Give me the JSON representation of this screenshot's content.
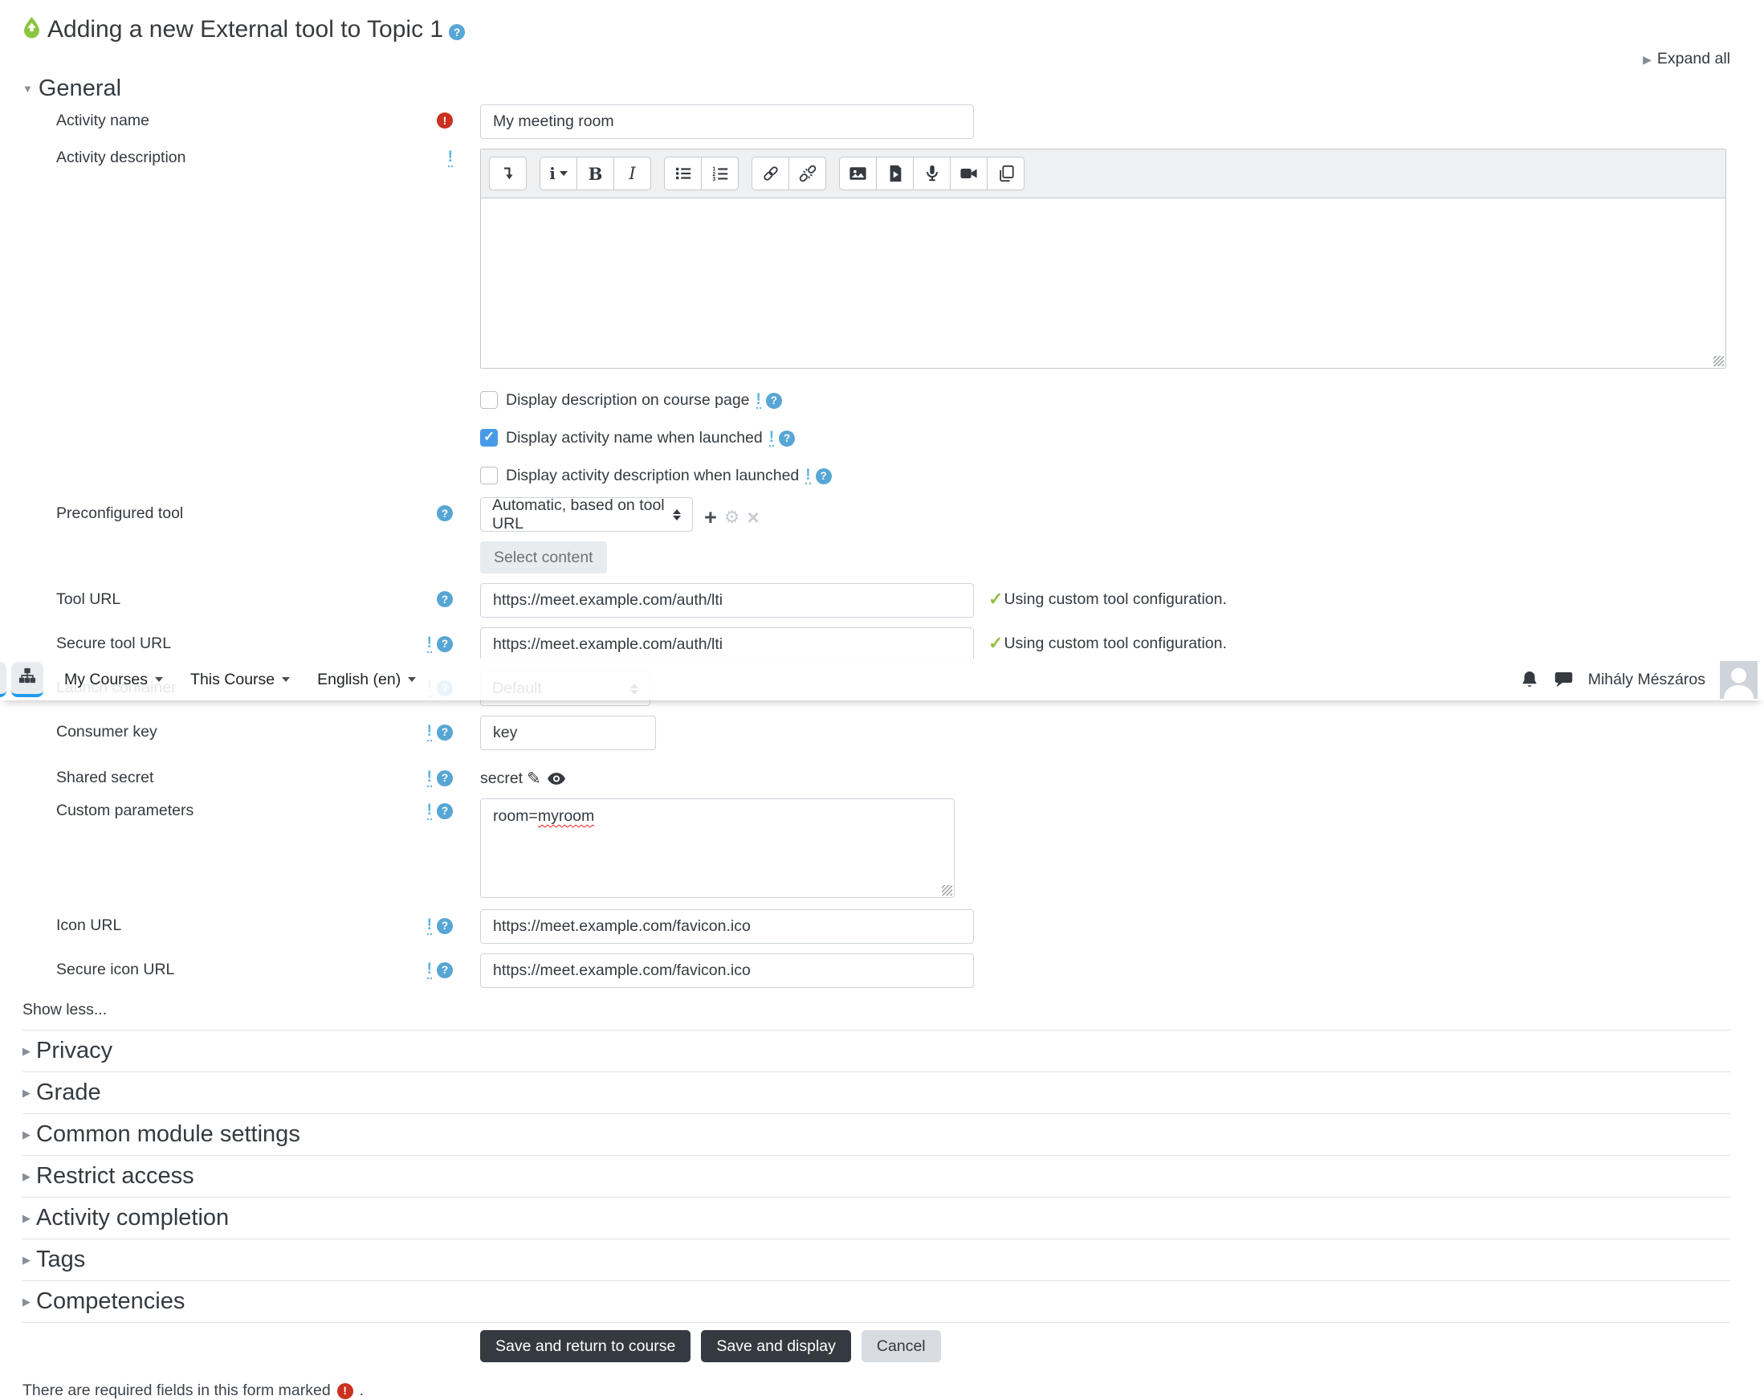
{
  "page": {
    "title": "Adding a new External tool to Topic 1",
    "expand_all": "Expand all"
  },
  "navbar": {
    "menus": [
      {
        "label": "My Courses"
      },
      {
        "label": "This Course"
      },
      {
        "label": "English (en)"
      }
    ],
    "icons": [
      "sitemap-icon",
      "bell-icon",
      "chat-icon"
    ],
    "user_name": "Mihály Mészáros"
  },
  "editor_toolbar": {
    "buttons": [
      "collapse-toolbar",
      "paragraph-styles",
      "bold",
      "italic",
      "unordered-list",
      "ordered-list",
      "link",
      "unlink",
      "insert-image",
      "insert-media",
      "record-audio",
      "record-video",
      "manage-files"
    ]
  },
  "form": {
    "general": {
      "heading": "General",
      "activity_name": {
        "label": "Activity name",
        "value": "My meeting room"
      },
      "activity_description": {
        "label": "Activity description"
      },
      "checkboxes": [
        {
          "label": "Display description on course page",
          "checked": false
        },
        {
          "label": "Display activity name when launched",
          "checked": true
        },
        {
          "label": "Display activity description when launched",
          "checked": false
        }
      ],
      "preconfigured_tool": {
        "label": "Preconfigured tool",
        "value": "Automatic, based on tool URL",
        "select_content_label": "Select content"
      },
      "tool_url": {
        "label": "Tool URL",
        "value": "https://meet.example.com/auth/lti",
        "status": "Using custom tool configuration."
      },
      "secure_tool_url": {
        "label": "Secure tool URL",
        "value": "https://meet.example.com/auth/lti",
        "status": "Using custom tool configuration."
      },
      "launch_container": {
        "label": "Launch container",
        "value": "Default"
      },
      "consumer_key": {
        "label": "Consumer key",
        "value": "key"
      },
      "shared_secret": {
        "label": "Shared secret",
        "value": "secret"
      },
      "custom_parameters": {
        "label": "Custom parameters",
        "value": "room=myroom",
        "prefix": "room=",
        "misspelled_word": "myroom"
      },
      "icon_url": {
        "label": "Icon URL",
        "value": "https://meet.example.com/favicon.ico"
      },
      "secure_icon_url": {
        "label": "Secure icon URL",
        "value": "https://meet.example.com/favicon.ico"
      },
      "show_less": "Show less..."
    },
    "sections": [
      {
        "label": "Privacy"
      },
      {
        "label": "Grade"
      },
      {
        "label": "Common module settings"
      },
      {
        "label": "Restrict access"
      },
      {
        "label": "Activity completion"
      },
      {
        "label": "Tags"
      },
      {
        "label": "Competencies"
      }
    ],
    "actions": {
      "save_return": "Save and return to course",
      "save_display": "Save and display",
      "cancel": "Cancel"
    },
    "required_note": "There are required fields in this form marked",
    "required_note_suffix": "."
  },
  "colors": {
    "help_badge": "#57a6d5",
    "required_badge": "#ca3120",
    "checkbox_checked": "#479be6",
    "success_check": "#94bf3f",
    "primary_button": "#343a40",
    "cancel_button": "#d8dbe0",
    "nav_active_underline": "#1d9bf0",
    "activity_icon_green": "#8ac63f",
    "spellcheck_underline": "#e0201a"
  }
}
